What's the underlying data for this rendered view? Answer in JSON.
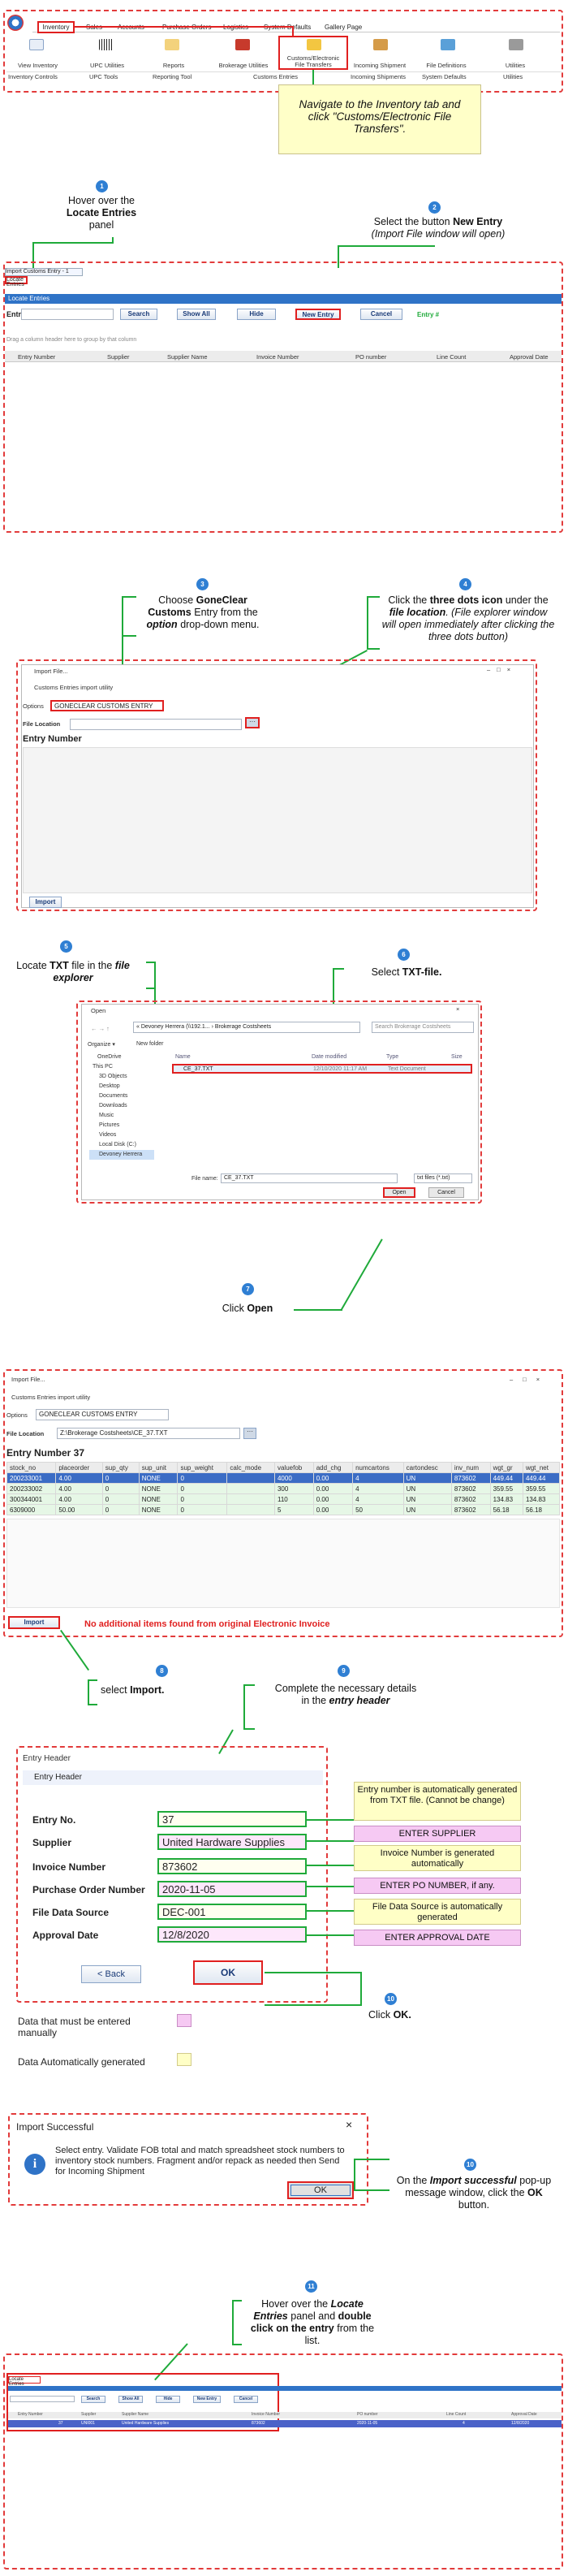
{
  "ribbon": {
    "tabs": [
      "Inventory",
      "Sales",
      "Accounts",
      "Purchase Orders",
      "Logistics",
      "System Defaults",
      "Gallery Page"
    ],
    "items": [
      "View Inventory",
      "UPC Utilities",
      "Reports",
      "Brokerage Utilities",
      "Customs/Electronic File Transfers",
      "Incoming Shipment",
      "File Definitions",
      "Utilities"
    ],
    "groups": [
      "Inventory Controls",
      "UPC Tools",
      "Reporting Tool",
      "Customs Entries",
      "Incoming Shipments",
      "System Defaults",
      "Utilities"
    ],
    "note": "Navigate to the Inventory tab and click \"Customs/Electronic File Transfers\"."
  },
  "step1": {
    "num": "1",
    "pre": "Hover over the",
    "bold": "Locate Entries",
    "post": "panel"
  },
  "step2": {
    "num": "2",
    "pre": "Select the button",
    "bold": "New Entry",
    "italic": "(Import File window will open)"
  },
  "locate_window": {
    "tabs": [
      "Import Customs Entry - 1",
      "Locate Entries"
    ],
    "title": "Locate Entries",
    "entry_label": "Entry #",
    "buttons": [
      "Search",
      "Show All",
      "Hide",
      "New Entry",
      "Cancel"
    ],
    "entry_right": "Entry #",
    "drag_hint": "Drag a column header here to group by that column",
    "columns": [
      "Entry Number",
      "Supplier",
      "Supplier Name",
      "Invoice Number",
      "PO number",
      "Line Count",
      "Approval Date"
    ]
  },
  "step3": {
    "num": "3",
    "pre": "Choose",
    "bold1": "GoneClear Customs",
    "mid": "Entry from the",
    "bold2": "option",
    "post": "drop-down menu."
  },
  "step4": {
    "num": "4",
    "pre": "Click the",
    "bold1": "three dots icon",
    "mid": "under the",
    "bold2": "file location",
    "italic": ". (File explorer window will open immediately after clicking the three dots button)"
  },
  "import_window": {
    "title": "Import File...",
    "subtitle": "Customs Entries import utility",
    "options_label": "Options",
    "option_value": "GONECLEAR CUSTOMS ENTRY",
    "file_location_label": "File Location",
    "entry_number_label": "Entry Number",
    "import_button": "Import"
  },
  "step5": {
    "num": "5",
    "pre": "Locate",
    "bold": "TXT",
    "mid": "file in the",
    "bi": "file explorer"
  },
  "step6": {
    "num": "6",
    "pre": "Select",
    "bold": "TXT-file."
  },
  "open_window": {
    "title": "Open",
    "path": "« Devoney Herrera (\\\\192.1... › Brokerage Costsheets",
    "search": "Search Brokerage Costsheets",
    "organize": "Organize ▾",
    "newfolder": "New folder",
    "sidebar": [
      "OneDrive",
      "This PC",
      "3D Objects",
      "Desktop",
      "Documents",
      "Downloads",
      "Music",
      "Pictures",
      "Videos",
      "Local Disk (C:)",
      "Devoney Herrera"
    ],
    "columns": [
      "Name",
      "Date modified",
      "Type",
      "Size"
    ],
    "file": {
      "name": "CE_37.TXT",
      "date": "12/10/2020 11:17 AM",
      "type": "Text Document",
      "size": "1 KB"
    },
    "filename_label": "File name:",
    "filename": "CE_37.TXT",
    "filter": "txt files (*.txt)",
    "open": "Open",
    "cancel": "Cancel"
  },
  "step7": {
    "num": "7",
    "pre": "Click",
    "bold": "Open"
  },
  "import_window2": {
    "title": "Import File...",
    "subtitle": "Customs Entries import utility",
    "options_label": "Options",
    "option_value": "GONECLEAR CUSTOMS ENTRY",
    "file_location_label": "File Location",
    "file_location": "Z:\\Brokerage Costsheets\\CE_37.TXT",
    "entry_number": "Entry Number 37",
    "columns": [
      "stock_no",
      "placeorder",
      "sup_qty",
      "sup_unit",
      "sup_weight",
      "calc_mode",
      "valuefob",
      "add_chg",
      "numcartons",
      "cartondesc",
      "inv_num",
      "wgt_gr",
      "wgt_net"
    ],
    "rows": [
      [
        "200233001",
        "4.00",
        "0",
        "NONE",
        "0",
        "",
        "4000",
        "0.00",
        "4",
        "UN",
        "873602",
        "449.44",
        "449.44"
      ],
      [
        "200233002",
        "4.00",
        "0",
        "NONE",
        "0",
        "",
        "300",
        "0.00",
        "4",
        "UN",
        "873602",
        "359.55",
        "359.55"
      ],
      [
        "300344001",
        "4.00",
        "0",
        "NONE",
        "0",
        "",
        "110",
        "0.00",
        "4",
        "UN",
        "873602",
        "134.83",
        "134.83"
      ],
      [
        "6309000",
        "50.00",
        "0",
        "NONE",
        "0",
        "",
        "5",
        "0.00",
        "50",
        "UN",
        "873602",
        "56.18",
        "56.18"
      ]
    ],
    "import_button": "Import",
    "message": "No additional items found from original Electronic Invoice"
  },
  "step8": {
    "num": "8",
    "pre": "select",
    "bold": "Import."
  },
  "step9": {
    "num": "9",
    "pre": "Complete the necessary details in the",
    "bi": "entry header"
  },
  "entry_header": {
    "title": "Entry Header",
    "subtitle": "Entry Header",
    "fields": [
      {
        "label": "Entry No.",
        "value": "37"
      },
      {
        "label": "Supplier",
        "value": "United Hardware Supplies"
      },
      {
        "label": "Invoice Number",
        "value": "873602"
      },
      {
        "label": "Purchase Order Number",
        "value": "2020-11-05"
      },
      {
        "label": "File Data Source",
        "value": "DEC-001"
      },
      {
        "label": "Approval Date",
        "value": "12/8/2020"
      }
    ],
    "back": "< Back",
    "ok": "OK",
    "notes": [
      "Entry number is automatically generated from TXT file. (Cannot be change)",
      "ENTER SUPPLIER",
      "Invoice Number is generated automatically",
      "ENTER PO NUMBER, if any.",
      "File Data Source is automatically generated",
      "ENTER APPROVAL DATE"
    ]
  },
  "step10": {
    "num": "10",
    "pre": "Click",
    "bold": "OK."
  },
  "legend": {
    "manual": "Data that must be entered manually",
    "auto": "Data Automatically generated"
  },
  "success_dialog": {
    "title": "Import Successful",
    "message": "Select entry. Validate FOB total and match spreadsheet stock numbers to inventory stock numbers. Fragment and/or repack as needed then Send for Incoming Shipment",
    "ok": "OK"
  },
  "step11": {
    "num": "10",
    "pre": "On the",
    "bi": "Import successful",
    "mid": "pop-up message window, click the",
    "bold": "OK",
    "post": "button."
  },
  "step12": {
    "num": "11",
    "pre": "Hover over the",
    "bi1": "Locate Entries",
    "mid": "panel and",
    "bold": "double click on the entry",
    "post": "from the list."
  },
  "final_list": {
    "title": "Locate Entries",
    "buttons": [
      "Search",
      "Show All",
      "Hide",
      "New Entry",
      "Cancel"
    ],
    "columns": [
      "Entry Number",
      "Supplier",
      "Supplier Name",
      "Invoice Number",
      "PO number",
      "Line Count",
      "Approval Date"
    ],
    "row": [
      "37",
      "UNI001",
      "United Hardware Supplies",
      "873602",
      "2020-11-05",
      "4",
      "12/8/2020"
    ]
  },
  "colors": {
    "blue": "#2f73c7",
    "red": "#e02020",
    "green": "#1faa3a",
    "pink": "#f6c9f3",
    "yellow": "#ffffc8"
  }
}
